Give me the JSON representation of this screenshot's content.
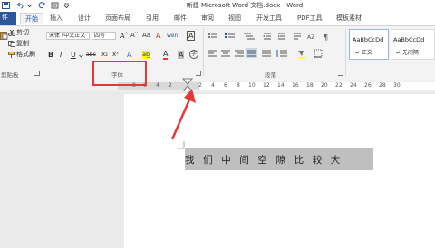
{
  "titlebar": {
    "title": "新建 Microsoft Word 文档.docx - Word"
  },
  "tabs": [
    {
      "label": "件"
    },
    {
      "label": "开始"
    },
    {
      "label": "插入"
    },
    {
      "label": "设计"
    },
    {
      "label": "页面布局"
    },
    {
      "label": "引用"
    },
    {
      "label": "邮件"
    },
    {
      "label": "审阅"
    },
    {
      "label": "视图"
    },
    {
      "label": "开发工具"
    },
    {
      "label": "PDF工具"
    },
    {
      "label": "模板素材"
    }
  ],
  "clipboard": {
    "cut": "剪切",
    "copy": "复制",
    "format_painter": "格式刷",
    "group_label": "剪贴板"
  },
  "font": {
    "font_name": "宋体 (中文正文",
    "font_size": "四号",
    "grow": "A˄",
    "shrink": "A˅",
    "case": "Aa",
    "clear": "A",
    "phonetic": "wén",
    "border": "A",
    "bold": "B",
    "italic": "I",
    "underline": "U",
    "strike": "abc",
    "subscript": "x₂",
    "superscript": "x²",
    "effect": "A",
    "highlight": "ab̲",
    "font_color": "A",
    "shade": "A",
    "circle": "字",
    "group_label": "字体"
  },
  "paragraph": {
    "group_label": "段落"
  },
  "styles": [
    {
      "sample": "AaBbCcDd",
      "name": "↵ 正文"
    },
    {
      "sample": "AaBbCcDd",
      "name": "↵ 无间隔"
    }
  ],
  "ruler": {
    "numbers": [
      "8",
      "6",
      "4",
      "2",
      "2",
      "4",
      "6",
      "8",
      "10",
      "12",
      "14",
      "16",
      "18",
      "20",
      "22",
      "24",
      "26",
      "28",
      "30"
    ]
  },
  "document": {
    "text": "我们中间空隙比较大"
  },
  "colors": {
    "accent": "#2b579a",
    "annotation": "#e53935"
  }
}
